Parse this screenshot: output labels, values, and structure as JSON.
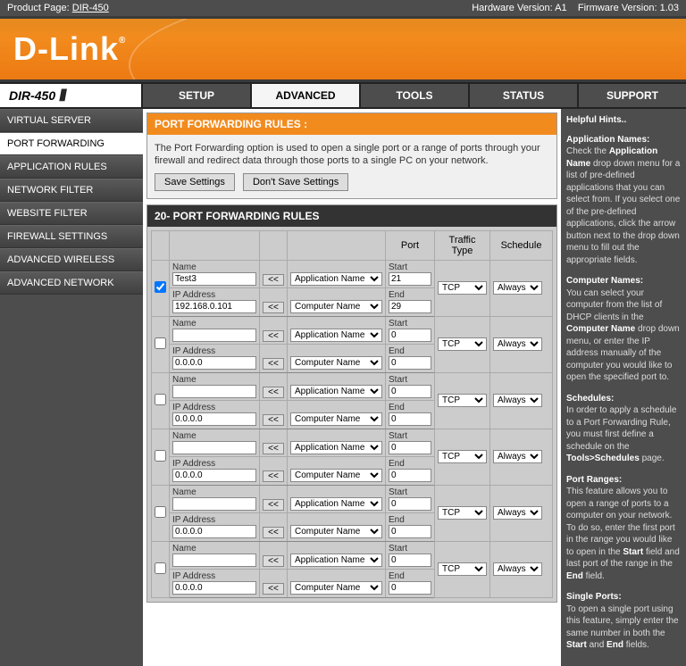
{
  "info": {
    "product_label": "Product Page:",
    "product_model": "DIR-450",
    "hw_label": "Hardware Version:",
    "hw_value": "A1",
    "fw_label": "Firmware Version:",
    "fw_value": "1.03"
  },
  "logo": "D-Link",
  "model": "DIR-450",
  "tabs": [
    "SETUP",
    "ADVANCED",
    "TOOLS",
    "STATUS",
    "SUPPORT"
  ],
  "active_tab": "ADVANCED",
  "sidebar": [
    "VIRTUAL SERVER",
    "PORT FORWARDING",
    "APPLICATION RULES",
    "NETWORK FILTER",
    "WEBSITE FILTER",
    "FIREWALL SETTINGS",
    "ADVANCED WIRELESS",
    "ADVANCED NETWORK"
  ],
  "active_side": "PORT FORWARDING",
  "pfr": {
    "title": "PORT FORWARDING RULES :",
    "desc": "The Port Forwarding option is used to open a single port or a range of ports through your firewall and redirect data through those ports to a single PC on your network.",
    "save": "Save Settings",
    "dont": "Don't Save Settings"
  },
  "rules_header": "20- PORT FORWARDING RULES",
  "cols": {
    "port": "Port",
    "traffic": "Traffic Type",
    "schedule": "Schedule"
  },
  "labels": {
    "name": "Name",
    "ip": "IP Address",
    "start": "Start",
    "end": "End"
  },
  "selects": {
    "app": "Application Name",
    "comp": "Computer Name",
    "arrow": "<<"
  },
  "traffic_opts": [
    "TCP"
  ],
  "sched_opts": [
    "Always"
  ],
  "rows": [
    {
      "checked": true,
      "name": "Test3",
      "ip": "192.168.0.101",
      "start": "21",
      "end": "29",
      "traffic": "TCP",
      "sched": "Always"
    },
    {
      "checked": false,
      "name": "",
      "ip": "0.0.0.0",
      "start": "0",
      "end": "0",
      "traffic": "TCP",
      "sched": "Always"
    },
    {
      "checked": false,
      "name": "",
      "ip": "0.0.0.0",
      "start": "0",
      "end": "0",
      "traffic": "TCP",
      "sched": "Always"
    },
    {
      "checked": false,
      "name": "",
      "ip": "0.0.0.0",
      "start": "0",
      "end": "0",
      "traffic": "TCP",
      "sched": "Always"
    },
    {
      "checked": false,
      "name": "",
      "ip": "0.0.0.0",
      "start": "0",
      "end": "0",
      "traffic": "TCP",
      "sched": "Always"
    },
    {
      "checked": false,
      "name": "",
      "ip": "0.0.0.0",
      "start": "0",
      "end": "0",
      "traffic": "TCP",
      "sched": "Always"
    }
  ],
  "help": {
    "title": "Helpful Hints..",
    "p1a": "Application Names:",
    "p1b": "Check the ",
    "p1c": "Application Name",
    "p1d": " drop down menu for a list of pre-defined applications that you can select from. If you select one of the pre-defined applications, click the arrow button next to the drop down menu to fill out the appropriate fields.",
    "p2a": "Computer Names:",
    "p2b": "You can select your computer from the list of DHCP clients in the ",
    "p2c": "Computer Name",
    "p2d": " drop down menu, or enter the IP address manually of the computer you would like to open the specified port to.",
    "p3a": "Schedules:",
    "p3b": "In order to apply a schedule to a Port Forwarding Rule, you must first define a schedule on the ",
    "p3c": "Tools>Schedules",
    "p3d": " page.",
    "p4a": "Port Ranges:",
    "p4b": "This feature allows you to open a range of ports to a computer on your network. To do so, enter the first port in the range you would like to open in the ",
    "p4c": "Start",
    "p4d": " field and last port of the range in the ",
    "p4e": "End",
    "p4f": " field.",
    "p5a": "Single Ports:",
    "p5b": "To open a single port using this feature, simply enter the same number in both the ",
    "p5c": "Start",
    "p5d": " and ",
    "p5e": "End",
    "p5f": " fields."
  }
}
